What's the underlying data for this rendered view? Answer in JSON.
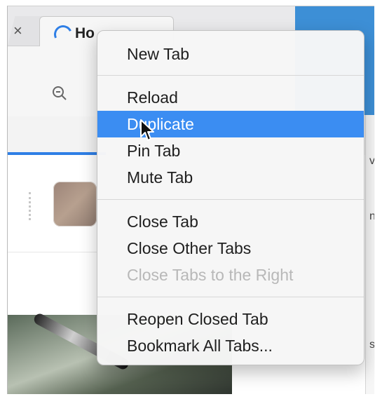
{
  "tabs": [
    {
      "label": "",
      "close_glyph": "×"
    },
    {
      "label": "Ho",
      "loading": true
    }
  ],
  "context_menu": {
    "items": [
      {
        "label": "New Tab",
        "enabled": true,
        "selected": false
      },
      {
        "label": "Reload",
        "enabled": true,
        "selected": false
      },
      {
        "label": "Duplicate",
        "enabled": true,
        "selected": true
      },
      {
        "label": "Pin Tab",
        "enabled": true,
        "selected": false
      },
      {
        "label": "Mute Tab",
        "enabled": true,
        "selected": false
      },
      {
        "label": "Close Tab",
        "enabled": true,
        "selected": false
      },
      {
        "label": "Close Other Tabs",
        "enabled": true,
        "selected": false
      },
      {
        "label": "Close Tabs to the Right",
        "enabled": false,
        "selected": false
      },
      {
        "label": "Reopen Closed Tab",
        "enabled": true,
        "selected": false
      },
      {
        "label": "Bookmark All Tabs...",
        "enabled": true,
        "selected": false
      }
    ]
  },
  "right_panel": {
    "text_1": "ve",
    "text_2": "nv",
    "text_3": "st"
  },
  "colors": {
    "menu_highlight": "#3b8df2",
    "loading_spinner": "#2f7fe6",
    "side_panel": "#3d8fd6",
    "disabled_text": "#b8b8b8"
  },
  "icons": {
    "tab_loading": "spinner-icon",
    "zoom_out": "zoom-out-icon",
    "cursor": "mouse-cursor-icon"
  }
}
